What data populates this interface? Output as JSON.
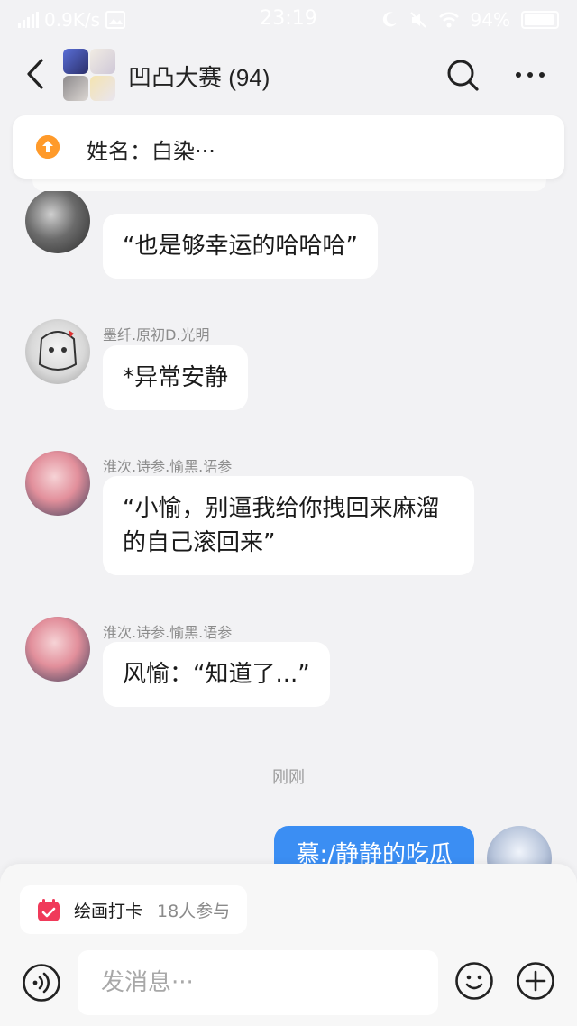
{
  "status_bar": {
    "net_speed": "0.9K/s",
    "time": "23:19",
    "battery": "94%",
    "battery_level": 0.94
  },
  "header": {
    "title": "凹凸大赛 (94)"
  },
  "pinned": {
    "text": "姓名：白染···"
  },
  "messages": [
    {
      "sender": "",
      "text": "“也是够幸运的哈哈哈”"
    },
    {
      "sender": "墨纤.原初D.光明",
      "text": "*异常安静"
    },
    {
      "sender": "淮次.诗参.愉黑.语参",
      "text": "“小愉，别逼我给你拽回来麻溜的自己滚回来”"
    },
    {
      "sender": "淮次.诗参.愉黑.语参",
      "text": "风愉：“知道了...”"
    }
  ],
  "timestamp": "刚刚",
  "my_message": {
    "text": "慕:/静静的吃瓜"
  },
  "checkin": {
    "label": "绘画打卡",
    "count": "18人参与"
  },
  "composer": {
    "placeholder": "发消息···"
  },
  "colors": {
    "background": "#f2f2f4",
    "my_bubble": "#3b8ef3",
    "pin_accent": "#ff9a2a",
    "checkin_icon": "#f03a5a"
  },
  "icons": {
    "back": "chevron-left-icon",
    "search": "search-icon",
    "more": "more-dots-icon",
    "pin": "arrow-up-circle-icon",
    "calendar": "calendar-icon",
    "voice": "voice-icon",
    "emoji": "smile-icon",
    "plus": "plus-circle-icon"
  }
}
